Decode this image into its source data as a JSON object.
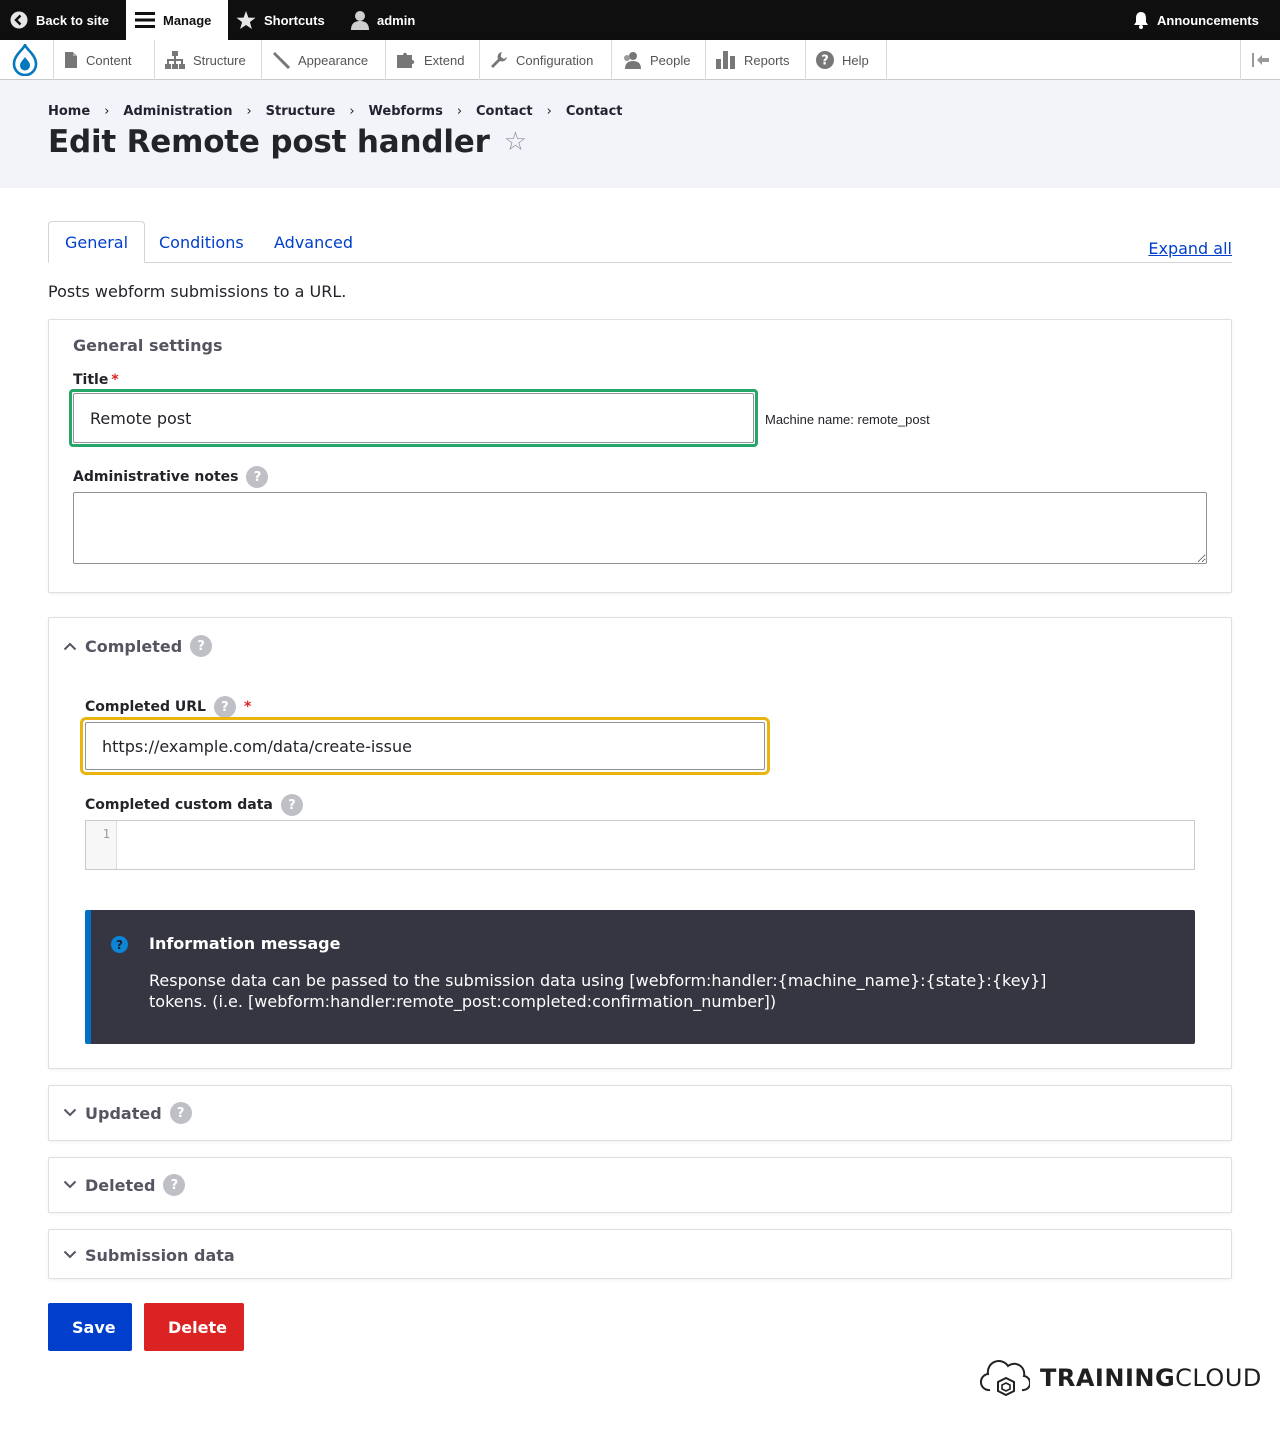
{
  "toolbar": {
    "back_to_site": "Back to site",
    "manage": "Manage",
    "shortcuts": "Shortcuts",
    "user": "admin",
    "announcements": "Announcements"
  },
  "tray": {
    "items": [
      "Content",
      "Structure",
      "Appearance",
      "Extend",
      "Configuration",
      "People",
      "Reports",
      "Help"
    ]
  },
  "breadcrumb": [
    "Home",
    "Administration",
    "Structure",
    "Webforms",
    "Contact",
    "Contact"
  ],
  "page": {
    "title": "Edit Remote post handler",
    "description": "Posts webform submissions to a URL."
  },
  "tabs": [
    "General",
    "Conditions",
    "Advanced"
  ],
  "expand_all": "Expand all",
  "general_settings": {
    "legend": "General settings",
    "title_label": "Title",
    "title_value": "Remote post",
    "machine_name": "Machine name: remote_post",
    "notes_label": "Administrative notes",
    "notes_value": ""
  },
  "completed": {
    "summary": "Completed",
    "url_label": "Completed URL",
    "url_value": "https://example.com/data/create-issue",
    "custom_data_label": "Completed custom data",
    "line_number": "1",
    "info_title": "Information message",
    "info_body": "Response data can be passed to the submission data using [webform:handler:{machine_name}:{state}:{key}] tokens. (i.e. [webform:handler:remote_post:completed:confirmation_number])"
  },
  "collapsed_sections": {
    "updated": "Updated",
    "deleted": "Deleted",
    "submission_data": "Submission data"
  },
  "actions": {
    "save": "Save",
    "delete": "Delete"
  },
  "brand": {
    "part1": "TRAINING",
    "part2": "CLOUD"
  },
  "colors": {
    "primary": "#003ecc",
    "danger": "#dc2323",
    "focus_green": "#26a769",
    "focus_yellow": "#e9b40f",
    "toolbar_bg": "#0f0f0f"
  }
}
